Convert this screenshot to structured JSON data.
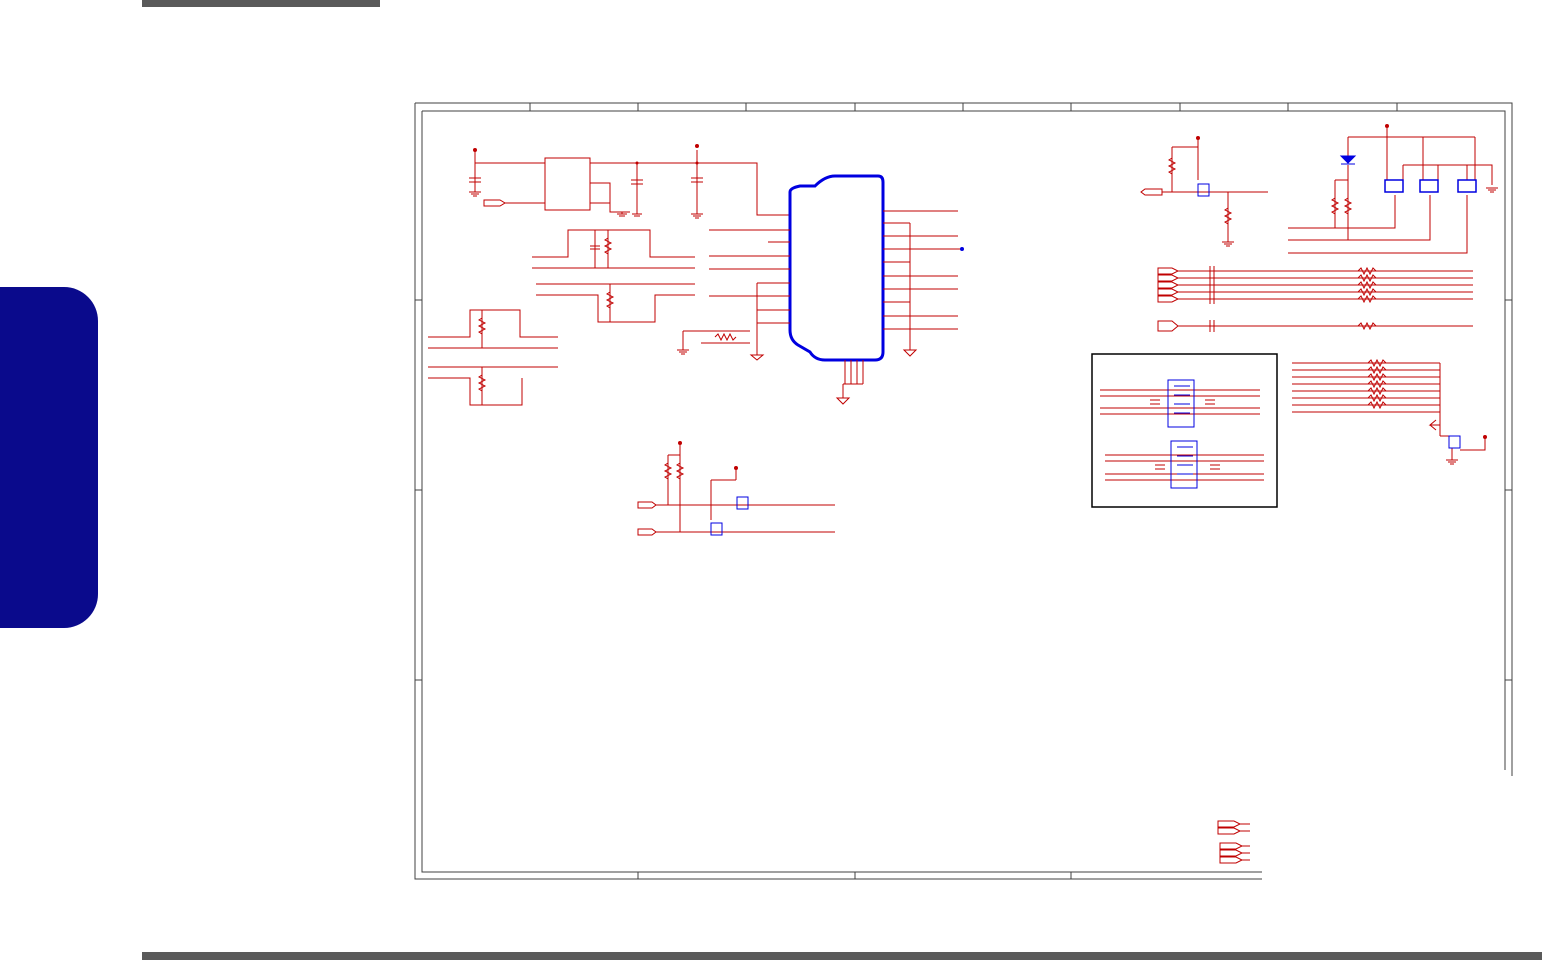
{
  "page": {
    "header_bar": "",
    "footer_bar": "",
    "side_tab_label": ""
  },
  "colors": {
    "wire": "#c00000",
    "component": "#0000e0",
    "border": "#404040",
    "tab": "#0a0a8c",
    "bar": "#5a5a5a"
  },
  "schematic": {
    "icons": [
      "resistor-icon",
      "capacitor-icon",
      "ground-icon",
      "mosfet-icon",
      "diode-icon",
      "port-flag-icon",
      "ic-chip-icon",
      "resistor-array-icon"
    ]
  }
}
